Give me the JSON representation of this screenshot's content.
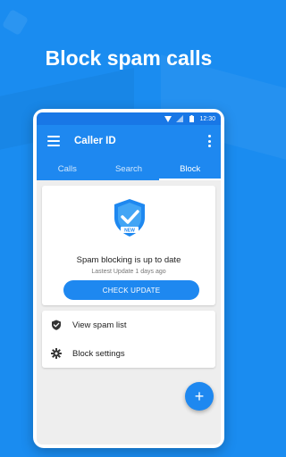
{
  "headline": "Block spam calls",
  "statusbar": {
    "time": "12:30"
  },
  "appbar": {
    "title": "Caller ID"
  },
  "tabs": [
    {
      "label": "Calls",
      "active": false
    },
    {
      "label": "Search",
      "active": false
    },
    {
      "label": "Block",
      "active": true
    }
  ],
  "status_card": {
    "badge": "NEW",
    "title": "Spam blocking is up to date",
    "subtitle": "Lastest Update 1 days ago",
    "button_label": "CHECK UPDATE"
  },
  "list": [
    {
      "label": "View spam list",
      "icon": "shield-check-icon"
    },
    {
      "label": "Block settings",
      "icon": "gear-icon"
    }
  ],
  "fab": {
    "label": "+"
  },
  "colors": {
    "background": "#1a8cf0",
    "primary": "#1e88f0",
    "statusbar": "#1877e6"
  }
}
